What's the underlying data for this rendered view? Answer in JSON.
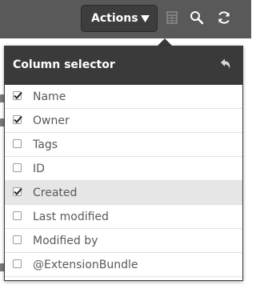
{
  "toolbar": {
    "actions_label": "Actions",
    "icons": [
      "table-icon",
      "search-icon",
      "refresh-icon"
    ]
  },
  "popover": {
    "title": "Column selector",
    "columns": [
      {
        "label": "Name",
        "checked": true
      },
      {
        "label": "Owner",
        "checked": true
      },
      {
        "label": "Tags",
        "checked": false
      },
      {
        "label": "ID",
        "checked": false
      },
      {
        "label": "Created",
        "checked": true,
        "highlighted": true
      },
      {
        "label": "Last modified",
        "checked": false
      },
      {
        "label": "Modified by",
        "checked": false
      },
      {
        "label": "@ExtensionBundle",
        "checked": false
      }
    ]
  },
  "colors": {
    "toolbar_bg": "#595959",
    "header_bg": "#3a3a3a",
    "row_highlight": "#e6e6e6",
    "label_text": "#595959"
  }
}
